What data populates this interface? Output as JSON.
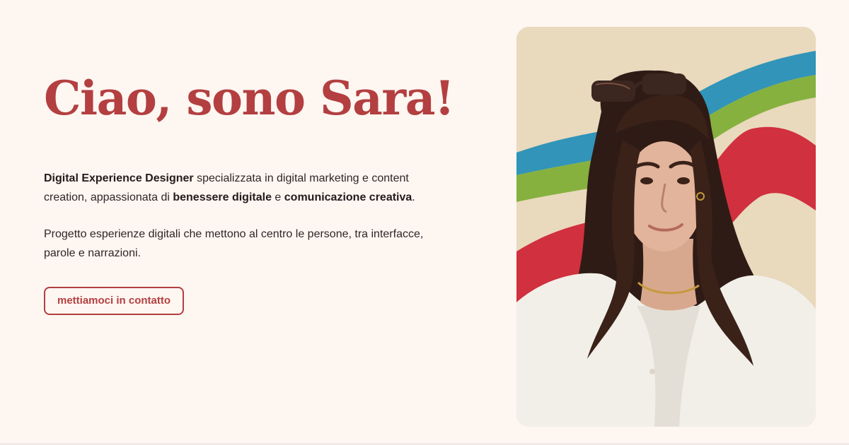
{
  "hero": {
    "title": "Ciao, sono Sara!",
    "intro": {
      "role": "Digital Experience Designer",
      "text_1": " specializzata in digital marketing e content creation, appassionata di ",
      "highlight_1": "benessere digitale",
      "text_2": " e ",
      "highlight_2": "comunicazione creativa",
      "text_3": "."
    },
    "paragraph_2": "Progetto esperienze digitali che mettono al centro le persone, tra interfacce, parole e narrazioni.",
    "cta_label": "mettiamoci in contatto"
  },
  "colors": {
    "background": "#fdf6f1",
    "accent": "#b33f40",
    "card_background": "#e9d9bd",
    "stripe_blue": "#3194b8",
    "stripe_green": "#86b13f",
    "stripe_red": "#d1303f",
    "shirt": "#f2efe9",
    "hair": "#2f1b15"
  },
  "photo": {
    "subject": "portrait-woman-sunglasses-on-head"
  }
}
